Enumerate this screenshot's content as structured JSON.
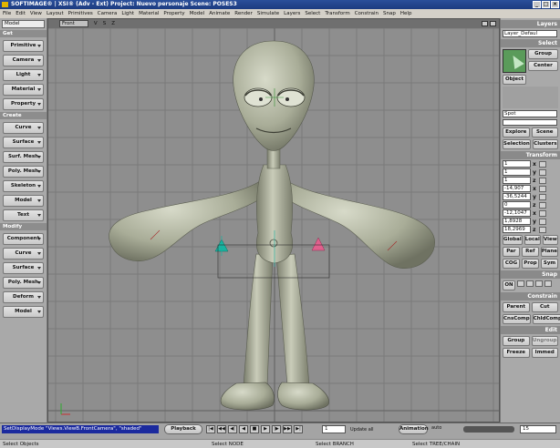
{
  "window": {
    "title": "SOFTIMAGE® | XSI® (Adv - Ext) Project: Nuevo personaje   Scene: POSES3",
    "controls": [
      "_",
      "□",
      "×"
    ]
  },
  "menu": [
    "File",
    "Edit",
    "View",
    "Layout",
    "Primitives",
    "Camera",
    "Light",
    "Material",
    "Property",
    "Model",
    "Animate",
    "Render",
    "Simulate",
    "Layers",
    "Select",
    "Transform",
    "Constrain",
    "Snap",
    "Help"
  ],
  "left_panel": {
    "mode": "Model",
    "sections": [
      {
        "title": "Get",
        "buttons": [
          "Primitive",
          "Camera",
          "Light",
          "Material",
          "Property"
        ]
      },
      {
        "title": "Create",
        "buttons": [
          "Curve",
          "Surface",
          "Surf. Mesh",
          "Poly. Mesh",
          "Skeleton",
          "Model",
          "Text"
        ]
      },
      {
        "title": "Modify",
        "buttons": [
          "Component",
          "Curve",
          "Surface",
          "Poly. Mesh",
          "Deform",
          "Model"
        ]
      }
    ]
  },
  "viewport": {
    "camera": "Front",
    "mode_letters": [
      "V",
      "S",
      "Z"
    ]
  },
  "right_panel": {
    "layers_header": "Layers",
    "layer_select": "Layer_Defaul",
    "select_header": "Select",
    "group_btn": "Group",
    "center_btn": "Center",
    "object_btn": "Object",
    "object_name": "Spot",
    "explore_btn": "Explore",
    "scene_btn": "Scene",
    "selection_btn": "Selection",
    "clusters_btn": "Clusters",
    "transform_header": "Transform",
    "scale": [
      "1",
      "1",
      "1"
    ],
    "rotation": [
      "-14,907",
      "-36,5244",
      "0"
    ],
    "translation": [
      "-12,1047",
      "1,8928",
      "18,2969"
    ],
    "axes": [
      "x",
      "y",
      "z"
    ],
    "space_buttons": [
      "Global",
      "Local",
      "View"
    ],
    "par_btns": [
      "Par",
      "Ref",
      "Plane"
    ],
    "cog_btns": [
      "COG",
      "Prop",
      "Sym"
    ],
    "snap_header": "Snap",
    "snap_on": "ON",
    "constrain_header": "Constrain",
    "parent_btn": "Parent",
    "cut_btn": "Cut",
    "coscomp_btn": "CnsComp",
    "chldcomp_btn": "ChldComp",
    "edit_header": "Edit",
    "group2_btn": "Group",
    "ungroup_btn": "Ungroup",
    "freeze_btn": "Freeze",
    "immed_btn": "Immed"
  },
  "timeline": {
    "command": "SetDisplayMode \"Views.ViewB.FrontCamera\", \"shaded\"",
    "playback": "Playback",
    "transport": [
      "|◀",
      "◀◀",
      "◀|",
      "◀",
      "■",
      "▶",
      "|▶",
      "▶▶",
      "▶|"
    ],
    "frame": "1",
    "update": "Update all",
    "animation": "Animation",
    "auto": "auto",
    "end_frame": "15"
  },
  "status": {
    "left": "Select Objects",
    "mid1": "Select NODE",
    "mid2": "Select BRANCH",
    "right": "Select TREE/CHAIN"
  },
  "colors": {
    "title_bar": "#1c3b80",
    "viewport_bg": "#8e8e8e",
    "grid": "#7a7a7a",
    "model": "#b9bcab",
    "command_bg": "#1b2a9e",
    "spot_marker": "#19b3a0",
    "pink_marker": "#e0608d"
  }
}
